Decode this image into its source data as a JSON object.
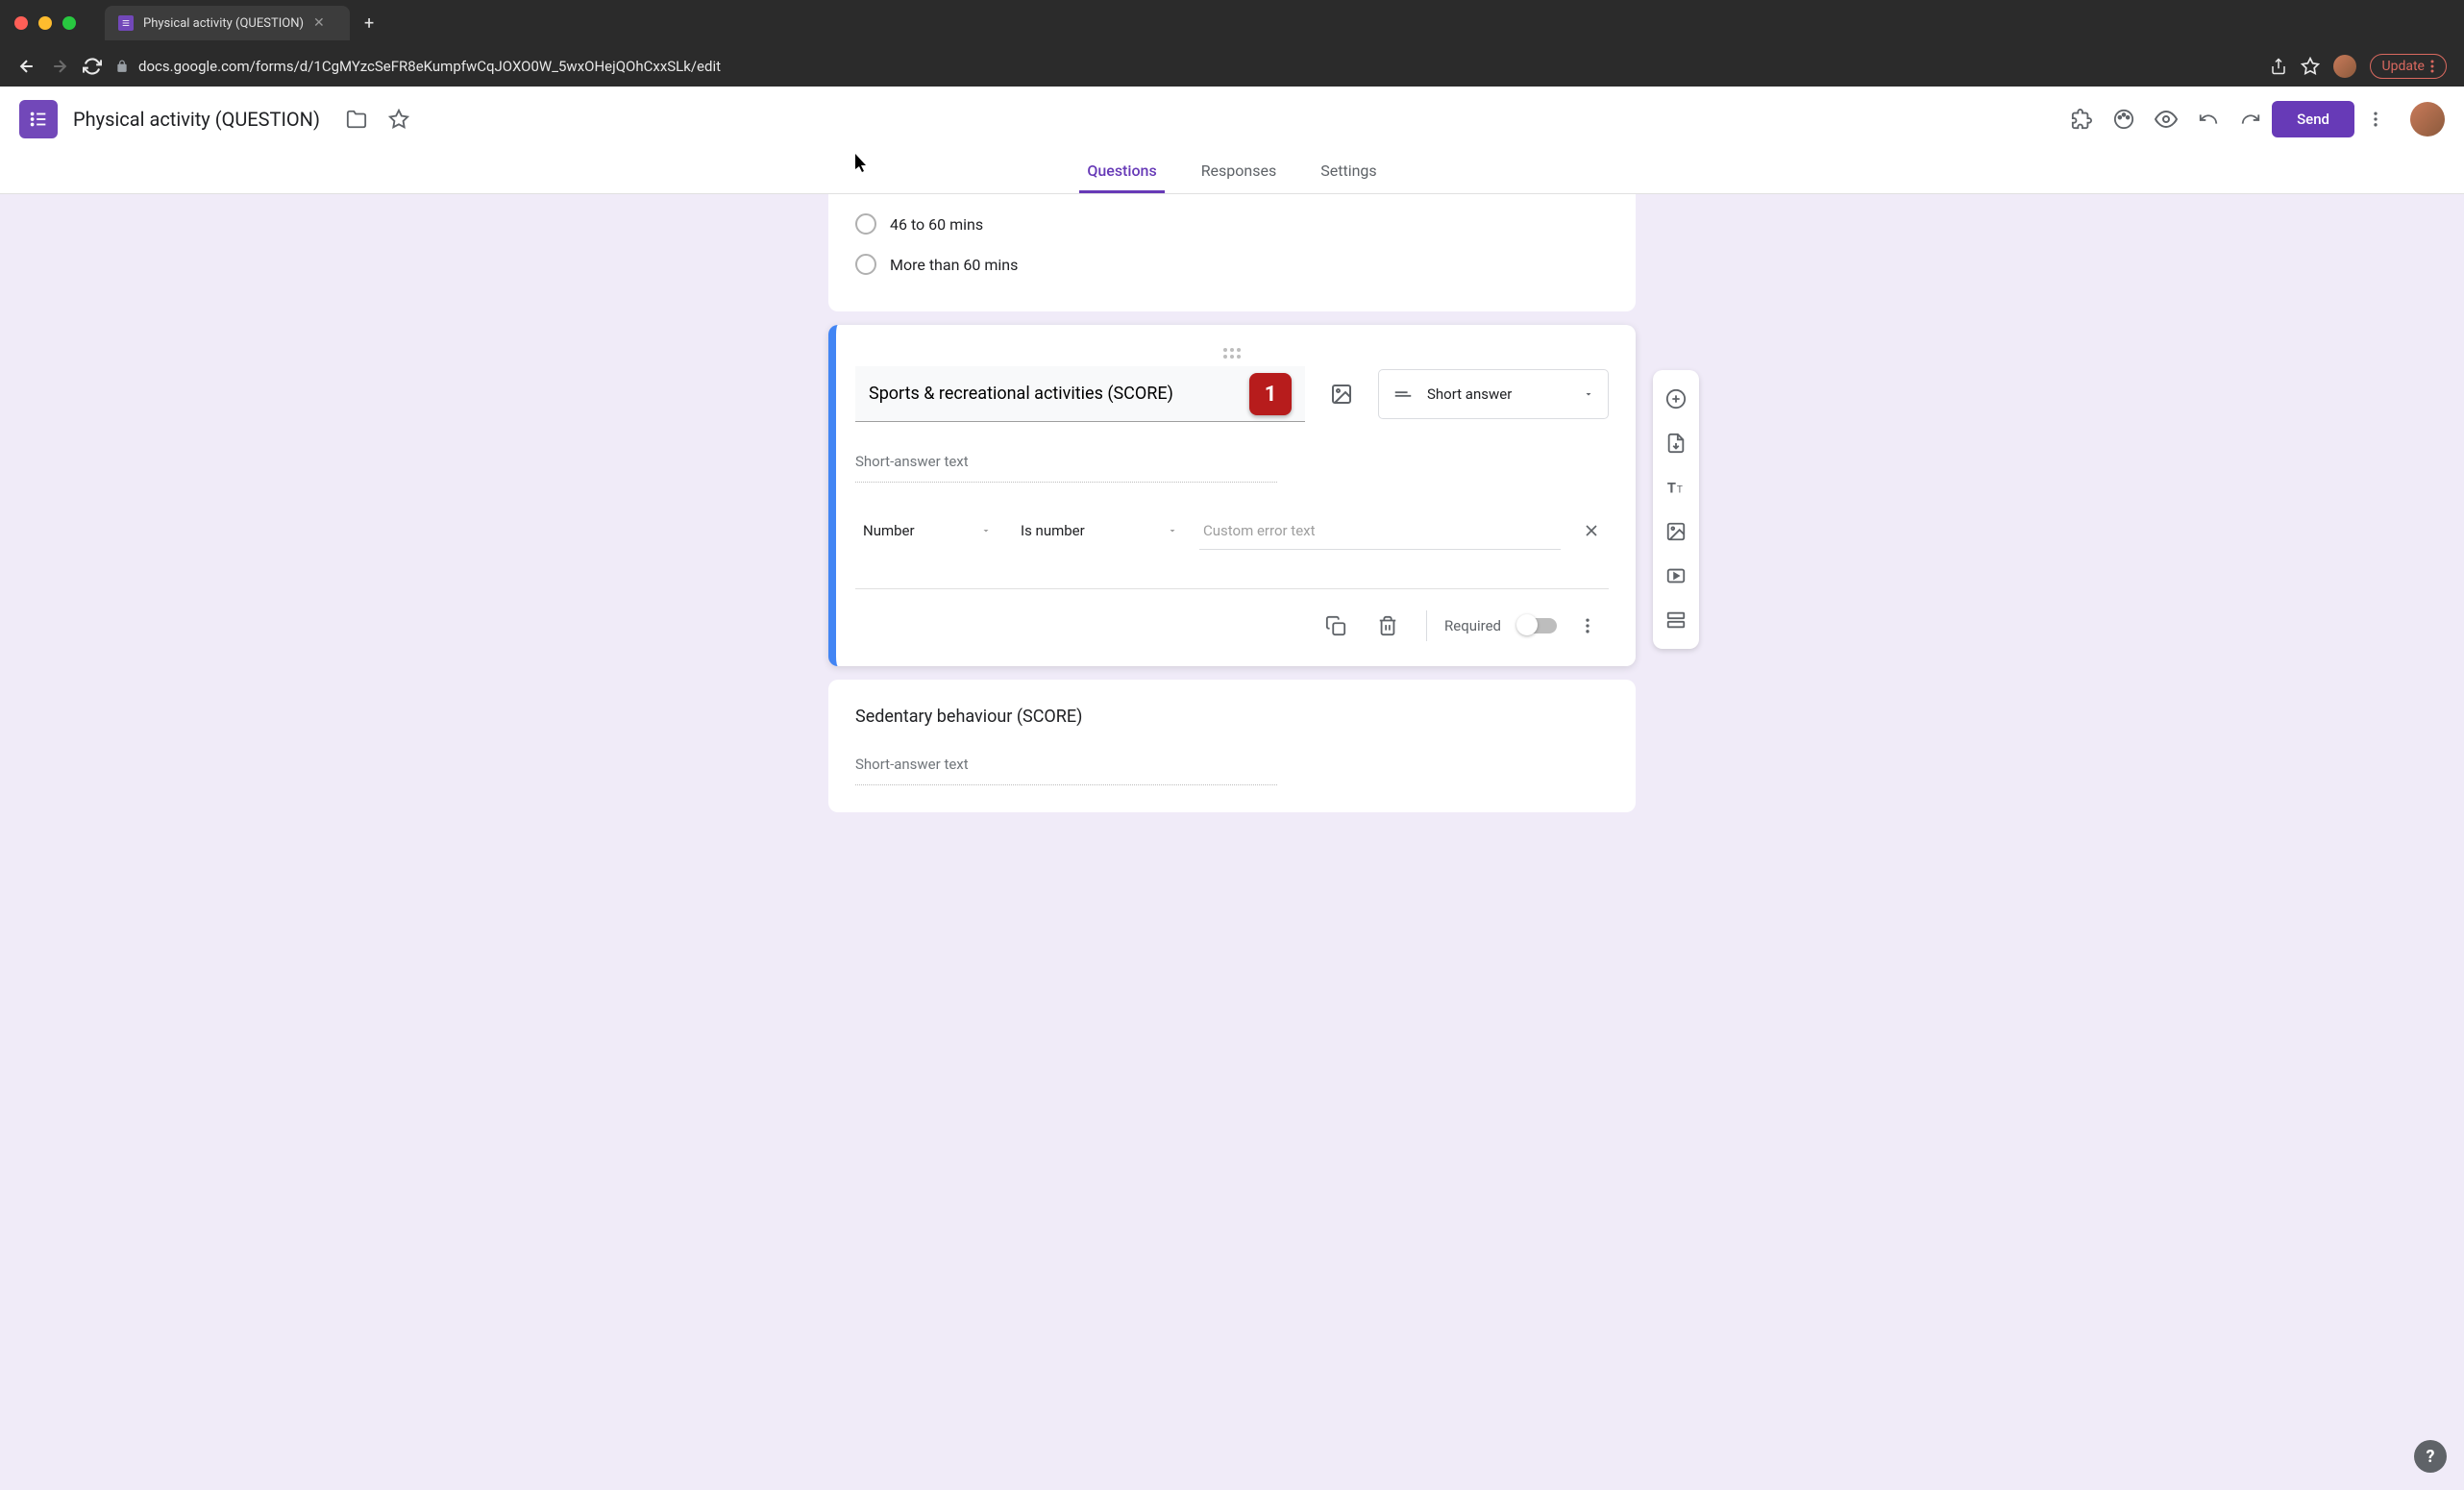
{
  "browser": {
    "tab_title": "Physical activity (QUESTION)",
    "url": "docs.google.com/forms/d/1CgMYzcSeFR8eKumpfwCqJOXO0W_5wxOHejQOhCxxSLk/edit",
    "update_label": "Update"
  },
  "header": {
    "form_title": "Physical activity (QUESTION)",
    "send_label": "Send",
    "tabs": {
      "questions": "Questions",
      "responses": "Responses",
      "settings": "Settings"
    }
  },
  "prev_question": {
    "options": [
      "46 to 60 mins",
      "More than 60 mins"
    ]
  },
  "active_question": {
    "title": "Sports & recreational activities (SCORE)",
    "badge": "1",
    "type_label": "Short answer",
    "short_answer_placeholder": "Short-answer text",
    "validation": {
      "type": "Number",
      "condition": "Is number",
      "error_placeholder": "Custom error text"
    },
    "required_label": "Required"
  },
  "next_question": {
    "title": "Sedentary behaviour (SCORE)",
    "short_answer_placeholder": "Short-answer text"
  }
}
